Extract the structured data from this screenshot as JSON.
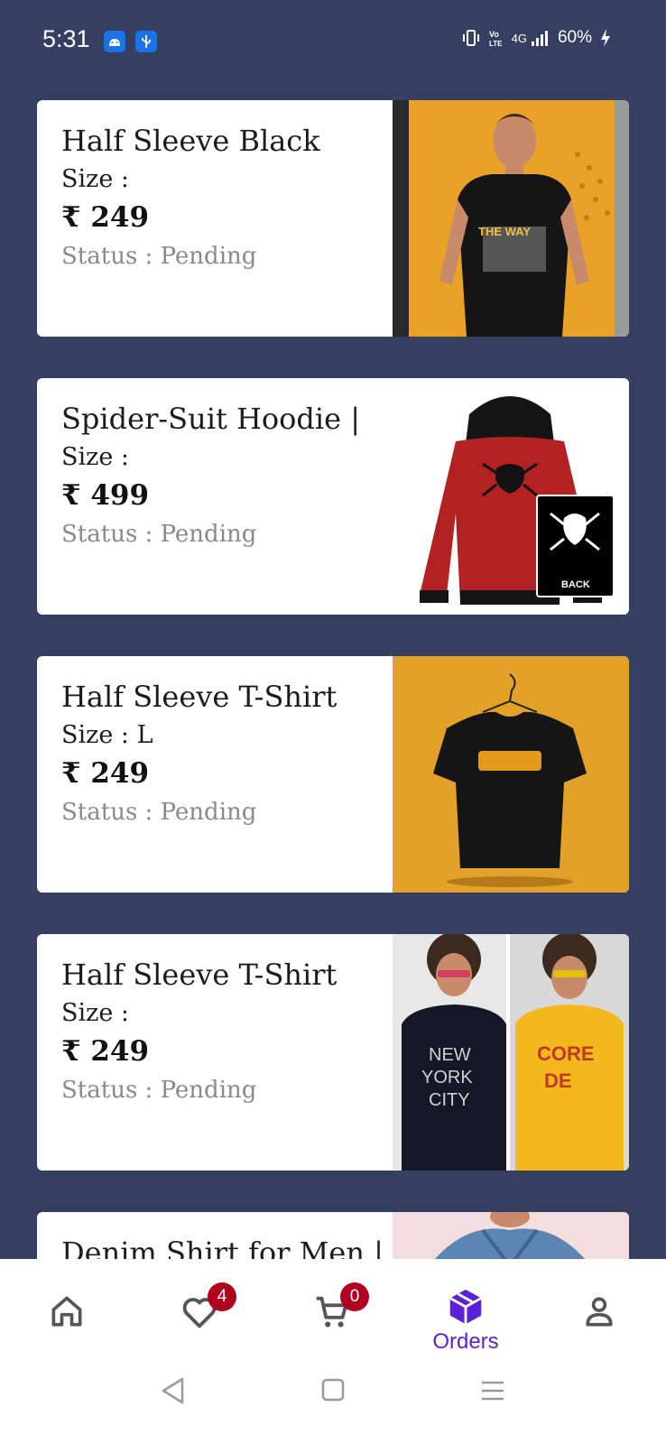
{
  "status_bar": {
    "time": "5:31",
    "network": "4G",
    "battery": "60%"
  },
  "orders": [
    {
      "title": "Half Sleeve Black",
      "size": "Size :",
      "price": "₹ 249",
      "status": "Status : Pending",
      "image": "black-tshirt-man-photo"
    },
    {
      "title": "Spider-Suit Hoodie |",
      "size": "Size :",
      "price": "₹ 499",
      "status": "Status : Pending",
      "image": "red-spider-hoodie-photo"
    },
    {
      "title": "Half Sleeve T-Shirt",
      "size": "Size : L",
      "price": "₹ 249",
      "status": "Status : Pending",
      "image": "black-tshirt-hanger-photo"
    },
    {
      "title": "Half Sleeve T-Shirt",
      "size": "Size :",
      "price": "₹ 249",
      "status": "Status : Pending",
      "image": "two-tshirts-models-photo"
    },
    {
      "title": "Denim Shirt for Men |",
      "size": "",
      "price": "",
      "status": "",
      "image": "denim-shirt-photo"
    }
  ],
  "bottom_nav": {
    "wishlist_count": "4",
    "cart_count": "0",
    "orders_label": "Orders",
    "accent": "#5b21d6"
  }
}
